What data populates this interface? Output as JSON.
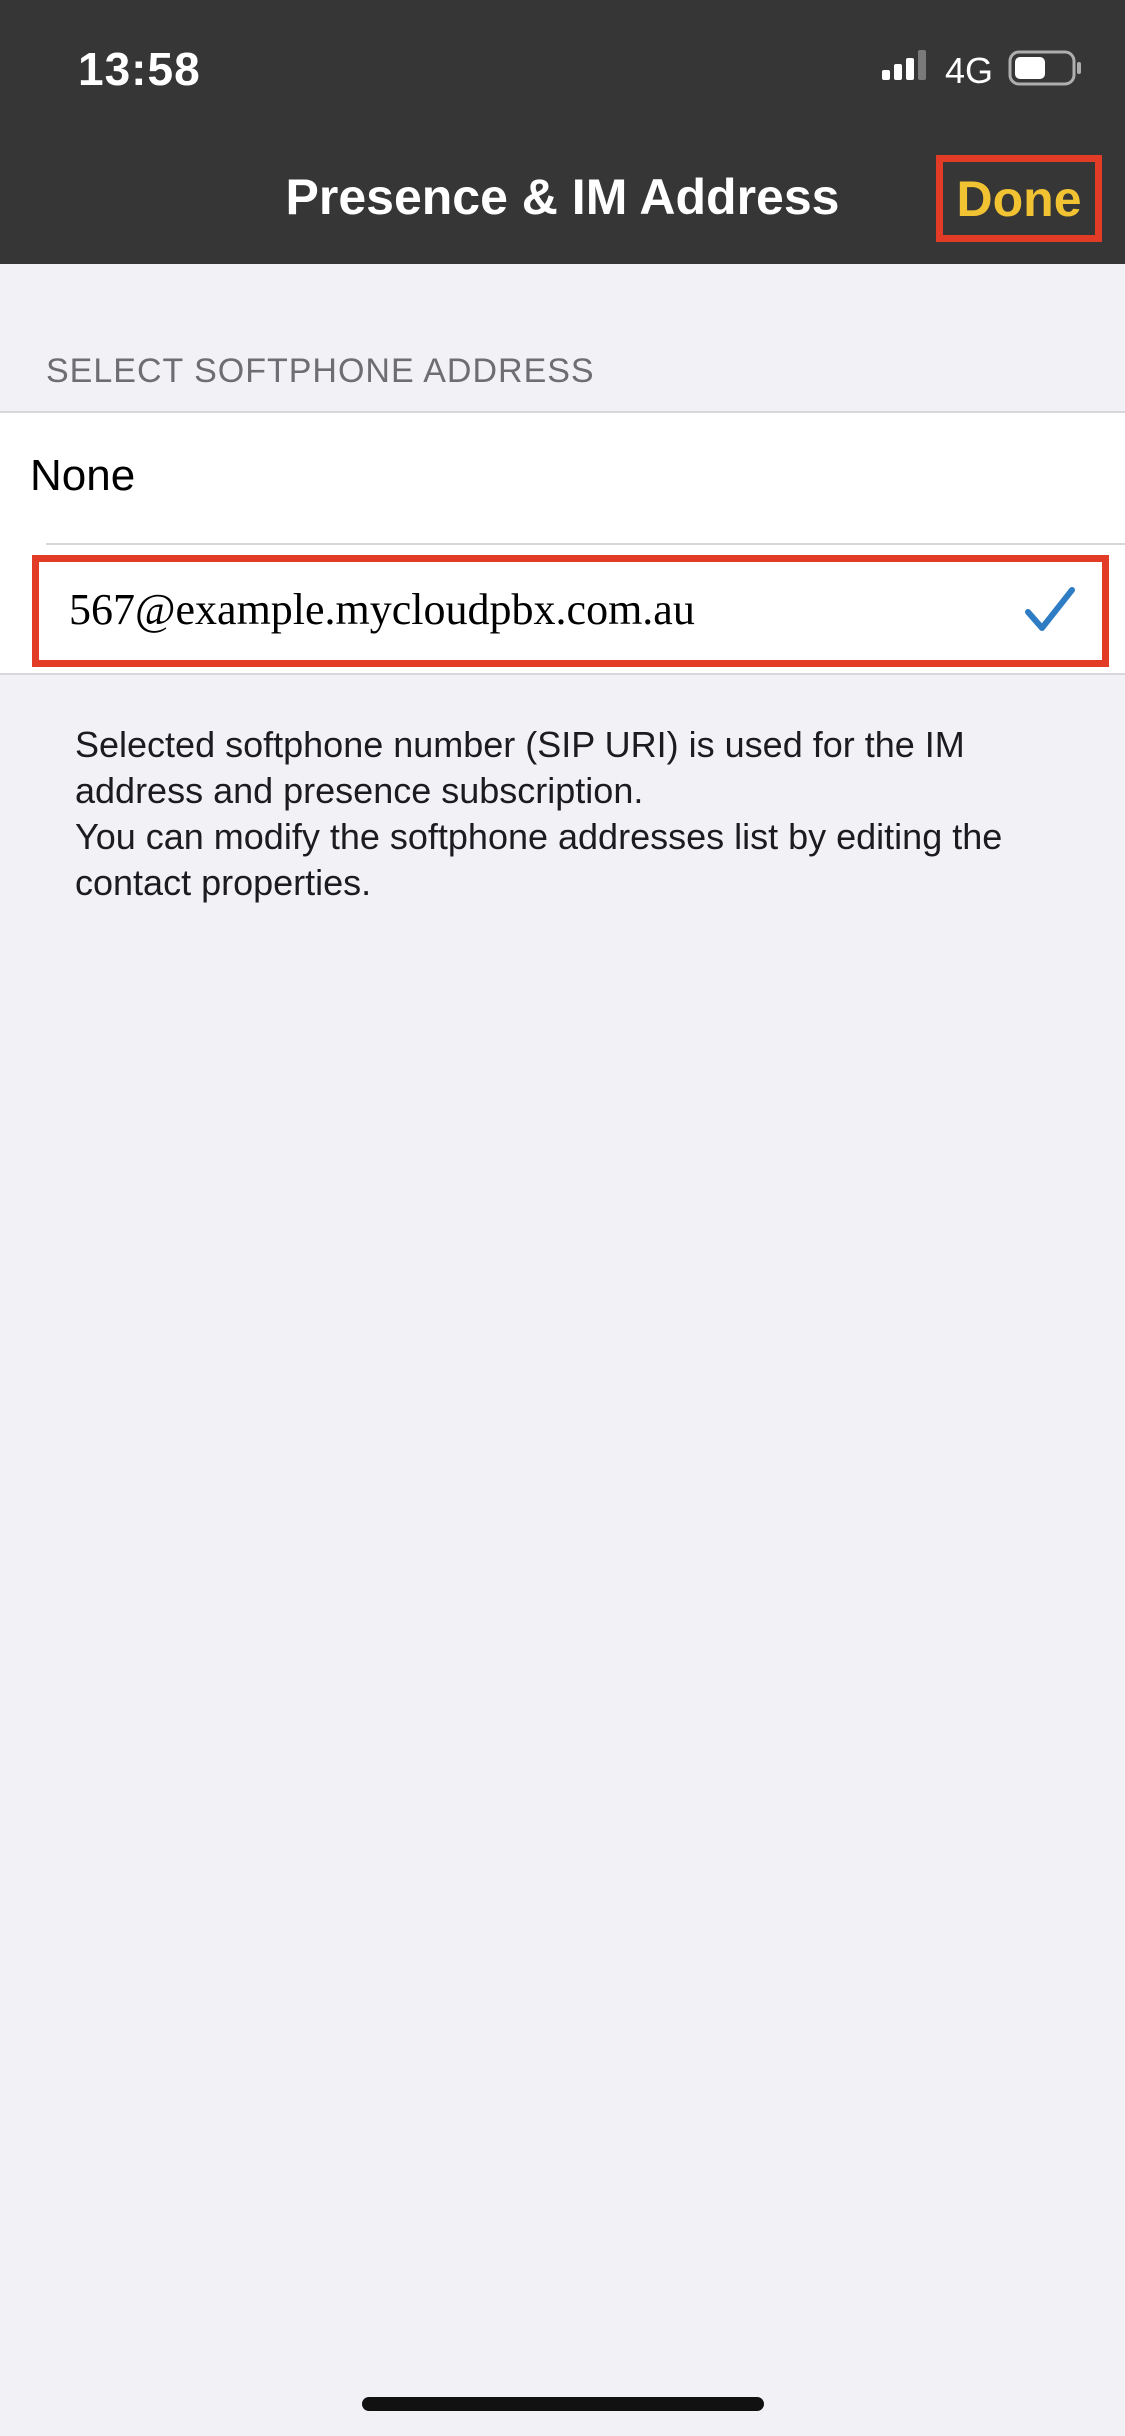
{
  "status_bar": {
    "time": "13:58",
    "network": "4G",
    "signal_icon": "cellular-signal-icon",
    "battery_icon": "battery-icon"
  },
  "nav_bar": {
    "title": "Presence & IM Address",
    "done_label": "Done"
  },
  "section": {
    "header": "SELECT SOFTPHONE ADDRESS",
    "options": [
      {
        "label": "None",
        "selected": false
      },
      {
        "label": "567@example.mycloudpbx.com.au",
        "selected": true
      }
    ],
    "footer_lines": [
      "Selected softphone number (SIP URI) is used for the IM address and presence subscription.",
      "You can modify the softphone addresses list by editing the contact properties."
    ]
  },
  "colors": {
    "header_bg": "#363636",
    "done_text": "#f1c232",
    "highlight_border": "#e23b26",
    "checkmark": "#2e7cc4",
    "background": "#f1f1f6"
  }
}
